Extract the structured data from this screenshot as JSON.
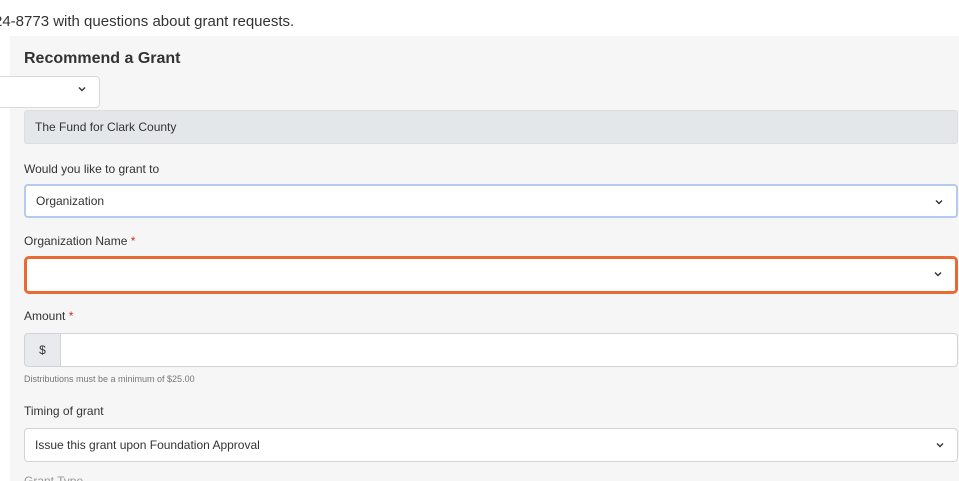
{
  "header": {
    "contact_text": "24-8773 with questions about grant requests."
  },
  "form": {
    "title": "Recommend a Grant",
    "fund_name": "The Fund for Clark County",
    "grant_to": {
      "label": "Would you like to grant to",
      "value": "Organization"
    },
    "org_name": {
      "label": "Organization Name",
      "required_mark": "*",
      "value": ""
    },
    "amount": {
      "label": "Amount",
      "required_mark": "*",
      "currency": "$",
      "value": "",
      "help": "Distributions must be a minimum of $25.00"
    },
    "timing": {
      "label": "Timing of grant",
      "value": "Issue this grant upon Foundation Approval"
    },
    "next_label": "Grant Type"
  },
  "icons": {
    "select_arrow": "chevron-down-icon"
  },
  "colors": {
    "focus_blue": "#b6c9ee",
    "error_orange": "#e96a33",
    "required_red": "#d9281c",
    "readonly_bg": "#e4e7ea"
  }
}
